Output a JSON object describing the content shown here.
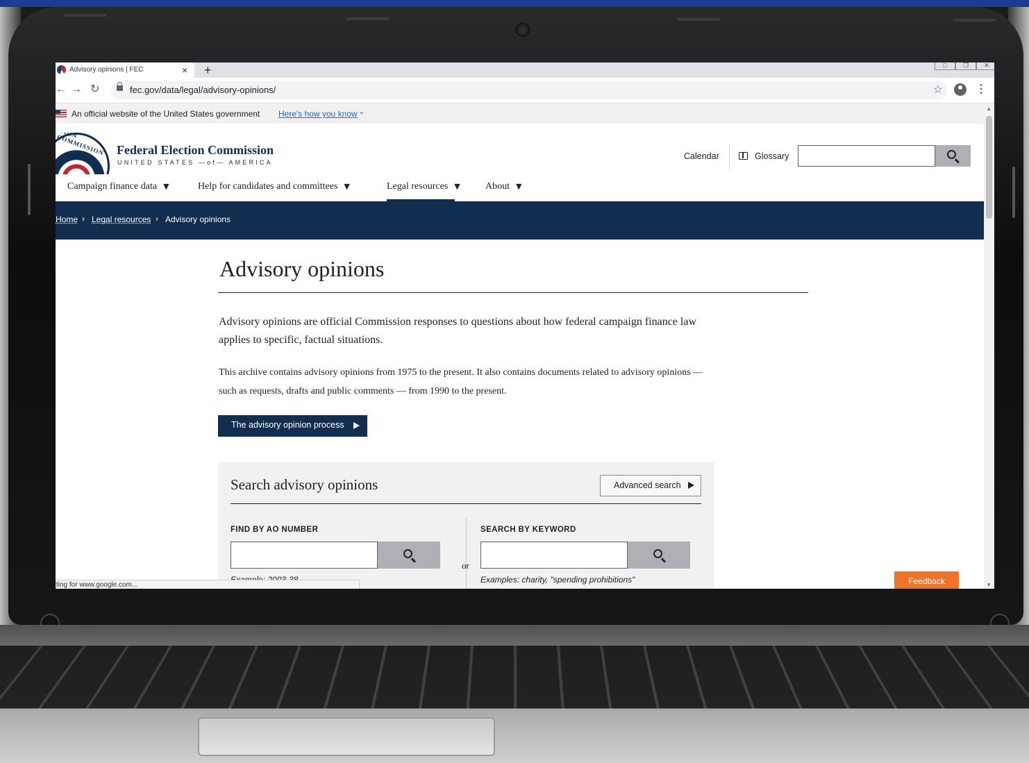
{
  "browser": {
    "tab_title": "Advisory opinions | FEC",
    "tab_close": "×",
    "new_tab": "+",
    "url": "fec.gov/data/legal/advisory-opinions/",
    "status_text": "ting for www.google.com..."
  },
  "gov_banner": {
    "text": "An official website of the United States government",
    "link": "Here's how you know"
  },
  "header": {
    "org_name": "Federal Election Commission",
    "org_sub": "UNITED STATES —of— AMERICA",
    "seal_text": "TION COMMISSION",
    "calendar": "Calendar",
    "glossary": "Glossary",
    "search_value": ""
  },
  "nav": {
    "items": [
      {
        "label": "Campaign finance data"
      },
      {
        "label": "Help for candidates and committees"
      },
      {
        "label": "Legal resources"
      },
      {
        "label": "About"
      }
    ],
    "active": "Legal resources"
  },
  "breadcrumb": {
    "home": "Home",
    "legal": "Legal resources",
    "current": "Advisory opinions",
    "sep": "›"
  },
  "page": {
    "title": "Advisory opinions",
    "lede": "Advisory opinions are official Commission responses to questions about how federal campaign finance law applies to specific, factual situations.",
    "body": "This archive contains advisory opinions from 1975 to the present. It also contains documents related to advisory opinions — such as requests, drafts and public comments — from 1990 to the present.",
    "process_button": "The advisory opinion process"
  },
  "search": {
    "title": "Search advisory opinions",
    "advanced_button": "Advanced search",
    "ao_label": "FIND BY AO NUMBER",
    "ao_example": "Example: 2003-38",
    "or": "or",
    "keyword_label": "SEARCH BY KEYWORD",
    "keyword_example": "Examples: charity, \"spending prohibitions\""
  },
  "feedback": "Feedback",
  "colors": {
    "navy": "#112e51",
    "feedback_orange": "#f0732c",
    "link_blue": "#2266d3"
  }
}
